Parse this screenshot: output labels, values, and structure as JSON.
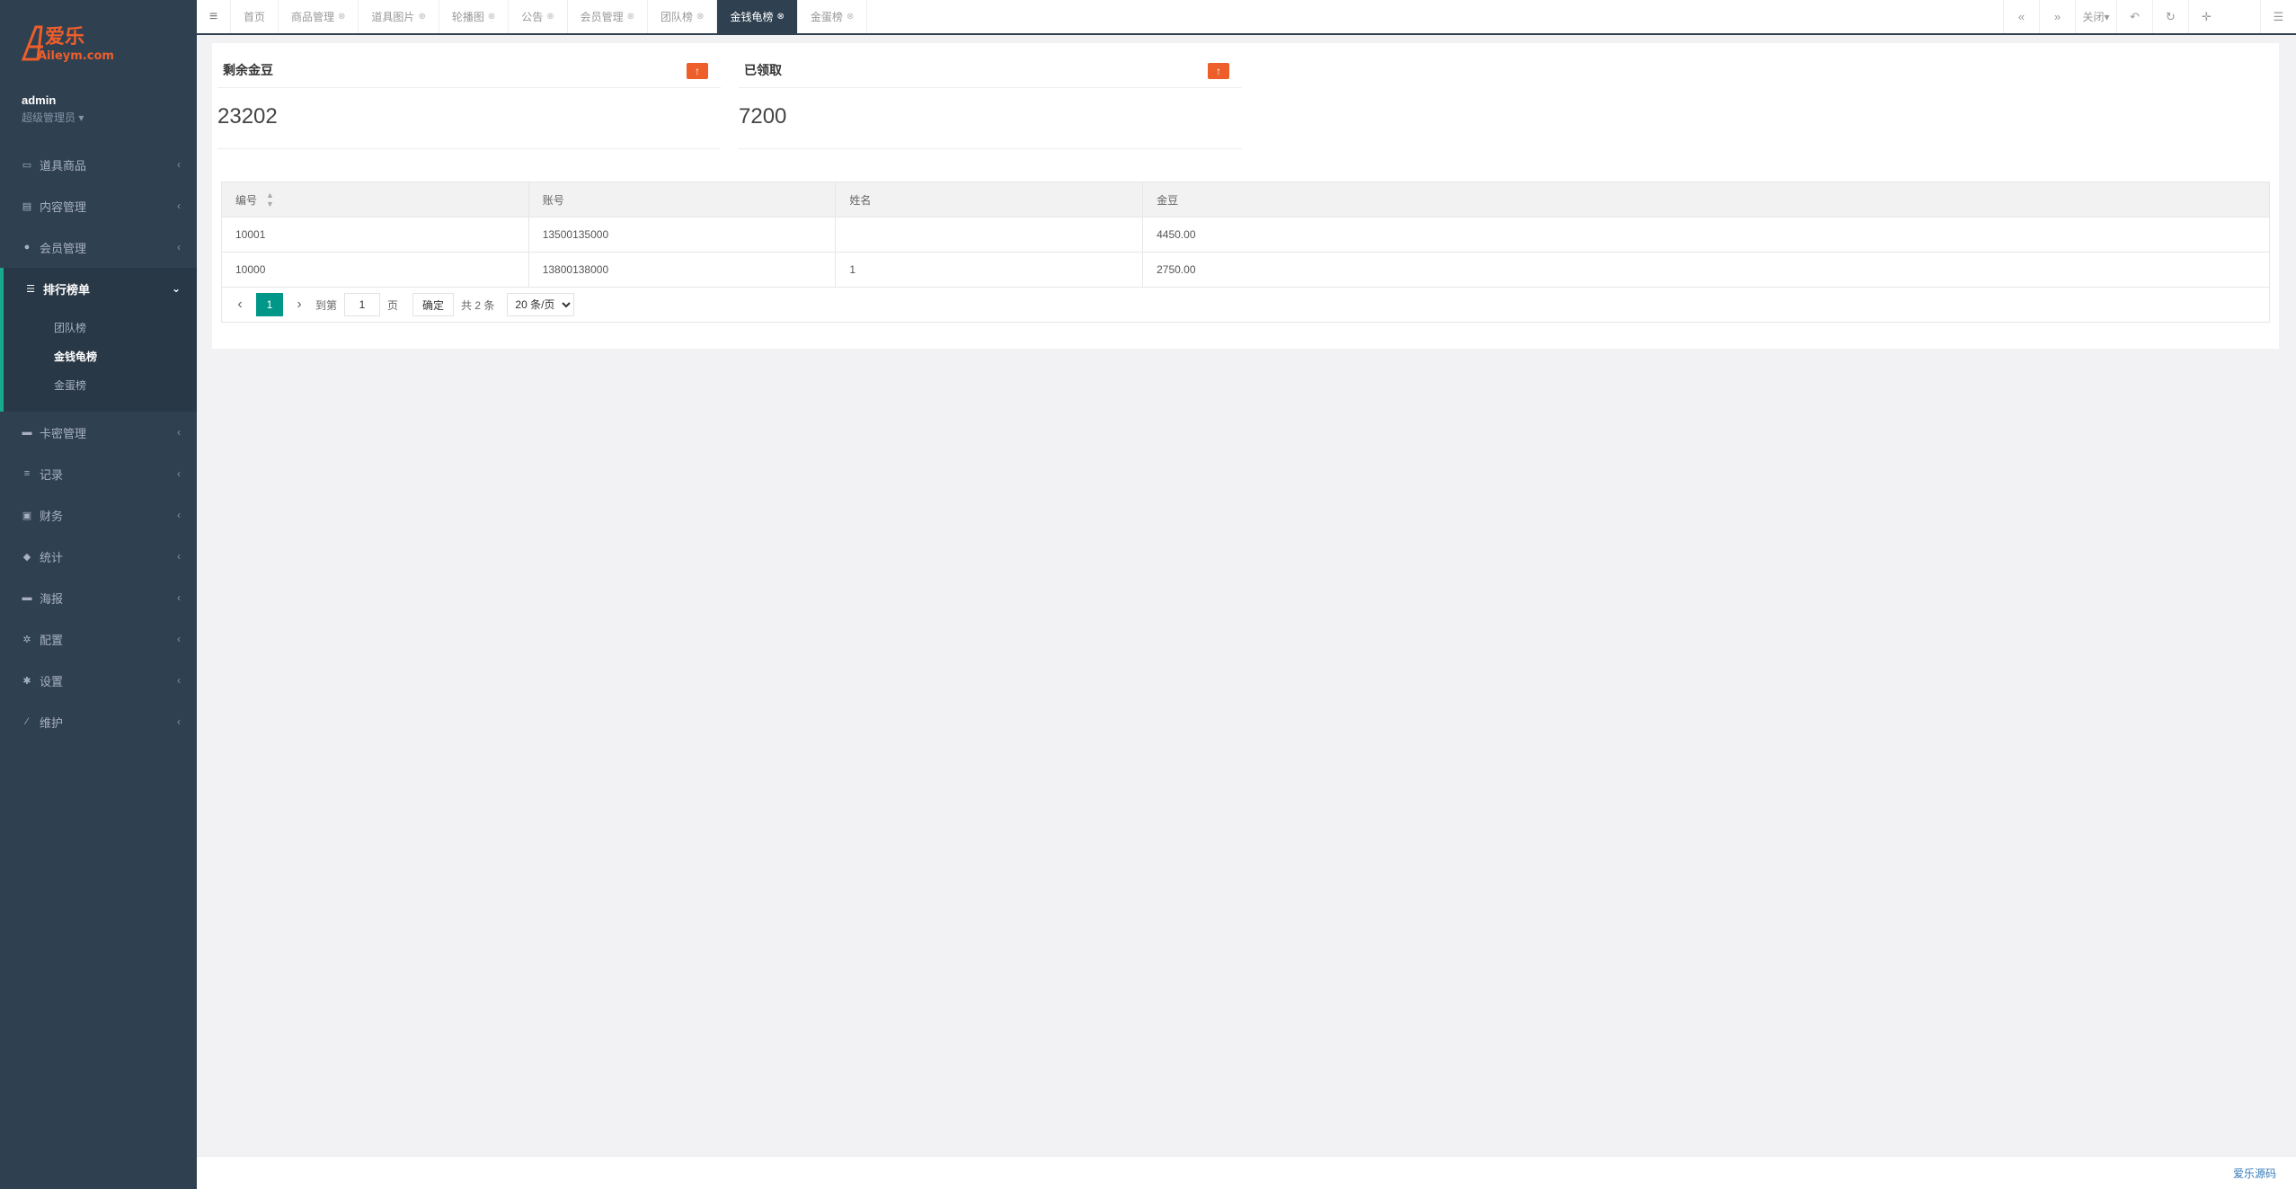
{
  "brand": {
    "logo_text": "爱乐",
    "logo_sub": "Aileym.com"
  },
  "profile": {
    "name": "admin",
    "role": "超级管理员"
  },
  "sidebar": {
    "items": [
      {
        "label": "道具商品",
        "icon": "laptop-icon"
      },
      {
        "label": "内容管理",
        "icon": "database-icon"
      },
      {
        "label": "会员管理",
        "icon": "user-icon"
      },
      {
        "label": "排行榜单",
        "icon": "list-icon"
      },
      {
        "label": "卡密管理",
        "icon": "card-icon"
      },
      {
        "label": "记录",
        "icon": "align-icon"
      },
      {
        "label": "财务",
        "icon": "money-icon"
      },
      {
        "label": "统计",
        "icon": "cubes-icon"
      },
      {
        "label": "海报",
        "icon": "card-icon"
      },
      {
        "label": "配置",
        "icon": "cogs-icon"
      },
      {
        "label": "设置",
        "icon": "gear-icon"
      },
      {
        "label": "维护",
        "icon": "wand-icon"
      }
    ],
    "sub_items": [
      "团队榜",
      "金钱龟榜",
      "金蛋榜"
    ]
  },
  "tabs": [
    {
      "label": "首页",
      "closable": false
    },
    {
      "label": "商品管理",
      "closable": true
    },
    {
      "label": "道具图片",
      "closable": true
    },
    {
      "label": "轮播图",
      "closable": true
    },
    {
      "label": "公告",
      "closable": true
    },
    {
      "label": "会员管理",
      "closable": true
    },
    {
      "label": "团队榜",
      "closable": true
    },
    {
      "label": "金钱龟榜",
      "closable": true
    },
    {
      "label": "金蛋榜",
      "closable": true
    }
  ],
  "toolbar": {
    "close_label": "关闭"
  },
  "stats": [
    {
      "title": "剩余金豆",
      "value": "23202"
    },
    {
      "title": "已领取",
      "value": "7200"
    }
  ],
  "table": {
    "columns": [
      "编号",
      "账号",
      "姓名",
      "金豆"
    ],
    "rows": [
      [
        "10001",
        "13500135000",
        "",
        "4450.00"
      ],
      [
        "10000",
        "13800138000",
        "1",
        "2750.00"
      ]
    ]
  },
  "pager": {
    "current": "1",
    "goto_label": "到第",
    "goto_value": "1",
    "page_label": "页",
    "confirm_label": "确定",
    "total_label": "共 2 条",
    "page_size": "20 条/页"
  },
  "footer": {
    "link": "爱乐源码"
  },
  "colors": {
    "sidebar_bg": "#2f4050",
    "accent": "#19aa8d",
    "pager_active": "#009688",
    "badge": "#ed5e2b"
  }
}
